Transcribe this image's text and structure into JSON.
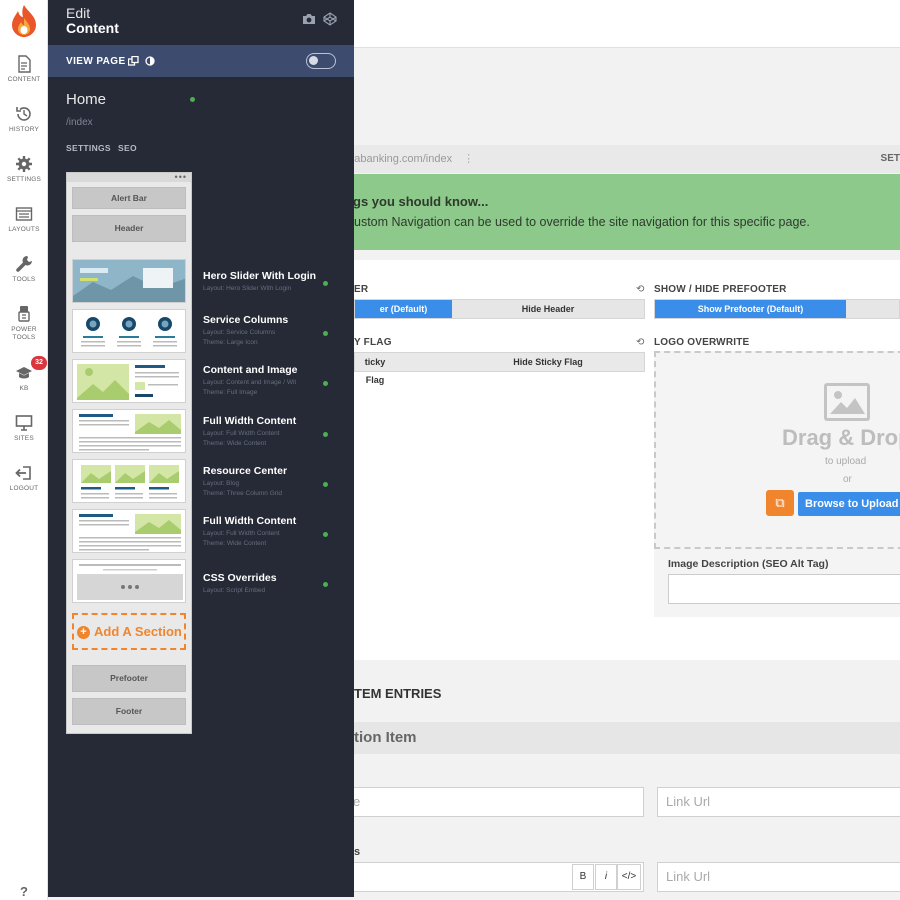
{
  "rail": {
    "items": [
      {
        "label": "CONTENT",
        "icon": "document-icon"
      },
      {
        "label": "HISTORY",
        "icon": "history-icon"
      },
      {
        "label": "SETTINGS",
        "icon": "gear-icon"
      },
      {
        "label": "LAYOUTS",
        "icon": "layouts-icon"
      },
      {
        "label": "TOOLS",
        "icon": "wrench-icon"
      },
      {
        "label": "POWER TOOLS",
        "icon": "power-tools-icon"
      },
      {
        "label": "KB",
        "icon": "graduation-cap-icon",
        "badge": "32"
      },
      {
        "label": "SITES",
        "icon": "monitor-icon"
      },
      {
        "label": "LOGOUT",
        "icon": "logout-icon"
      }
    ],
    "help": "?"
  },
  "editor": {
    "title_line1": "Edit",
    "title_line2": "Content",
    "view_page": "VIEW PAGE",
    "page_name": "Home",
    "page_path": "/index",
    "tabs": [
      "SETTINGS",
      "SEO"
    ],
    "minimap": {
      "top_bars": [
        "Alert Bar",
        "Header"
      ],
      "add_section": "Add A Section",
      "bottom_bars": [
        "Prefooter",
        "Footer"
      ],
      "more_dots": "•••"
    },
    "sections": [
      {
        "name": "Hero Slider With Login",
        "meta1": "Layout: Hero Slider With Login",
        "meta2": ""
      },
      {
        "name": "Service Columns",
        "meta1": "Layout: Service Columns",
        "meta2": "Theme: Large Icon"
      },
      {
        "name": "Content and Image",
        "meta1": "Layout: Content and Image / Wit",
        "meta2": "Theme: Full Image"
      },
      {
        "name": "Full Width Content",
        "meta1": "Layout: Full Width Content",
        "meta2": "Theme: Wide Content"
      },
      {
        "name": "Resource Center",
        "meta1": "Layout: Blog",
        "meta2": "Theme: Three Column Grid"
      },
      {
        "name": "Full Width Content",
        "meta1": "Layout: Full Width Content",
        "meta2": "Theme: Wide Content"
      },
      {
        "name": "CSS Overrides",
        "meta1": "Layout: Script Embed",
        "meta2": ""
      }
    ],
    "status_color": "#4caf50"
  },
  "background": {
    "url": "rgiabanking.com/index",
    "settings_cut": "SET",
    "notice_title": "gs you should know...",
    "notice_text": "ustom Navigation can be used to override the site navigation for this specific page.",
    "header_label": "ER",
    "header_on": "er (Default)",
    "header_off": "Hide Header",
    "prefooter_label": "SHOW / HIDE PREFOOTER",
    "prefooter_on": "Show Prefooter (Default)",
    "flag_label": "Y FLAG",
    "flag_on": "ticky Flag",
    "flag_off": "Hide Sticky Flag",
    "logo_label": "LOGO OVERWRITE",
    "drop_big": "Drag & Drop",
    "drop_to_upload": "to upload",
    "drop_or": "or",
    "browse": "Browse to Upload",
    "image_desc_label": "Image Description (SEO Alt Tag)",
    "entries_head": "TEM ENTRIES",
    "item_bar": "tion Item",
    "input_left1": "e",
    "input_right1": "Link Url",
    "row2_label": "s",
    "input_right2": "Link Url",
    "fmt_bold": "B",
    "fmt_italic": "i",
    "fmt_code": "</>",
    "accent": "#3a8de8",
    "notice_color": "#8dc98a"
  }
}
